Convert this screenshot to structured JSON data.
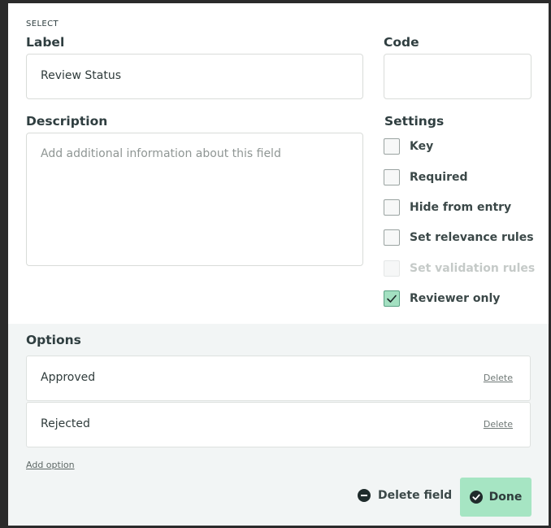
{
  "field_type": "SELECT",
  "label_field": {
    "heading": "Label",
    "value": "Review Status"
  },
  "code_field": {
    "heading": "Code",
    "value": ""
  },
  "description_field": {
    "heading": "Description",
    "placeholder": "Add additional information about this field"
  },
  "settings": {
    "heading": "Settings",
    "items": [
      {
        "label": "Key",
        "checked": false,
        "disabled": false
      },
      {
        "label": "Required",
        "checked": false,
        "disabled": false
      },
      {
        "label": "Hide from entry",
        "checked": false,
        "disabled": false
      },
      {
        "label": "Set relevance rules",
        "checked": false,
        "disabled": false
      },
      {
        "label": "Set validation rules",
        "checked": false,
        "disabled": true
      },
      {
        "label": "Reviewer only",
        "checked": true,
        "disabled": false
      }
    ]
  },
  "options": {
    "heading": "Options",
    "items": [
      {
        "label": "Approved",
        "delete_label": "Delete"
      },
      {
        "label": "Rejected",
        "delete_label": "Delete"
      }
    ],
    "add_label": "Add option"
  },
  "actions": {
    "delete_field_label": "Delete field",
    "done_label": "Done"
  },
  "colors": {
    "accent": "#a6e5c3",
    "options_bg": "#f2f5f5",
    "text": "#2f3e40"
  }
}
